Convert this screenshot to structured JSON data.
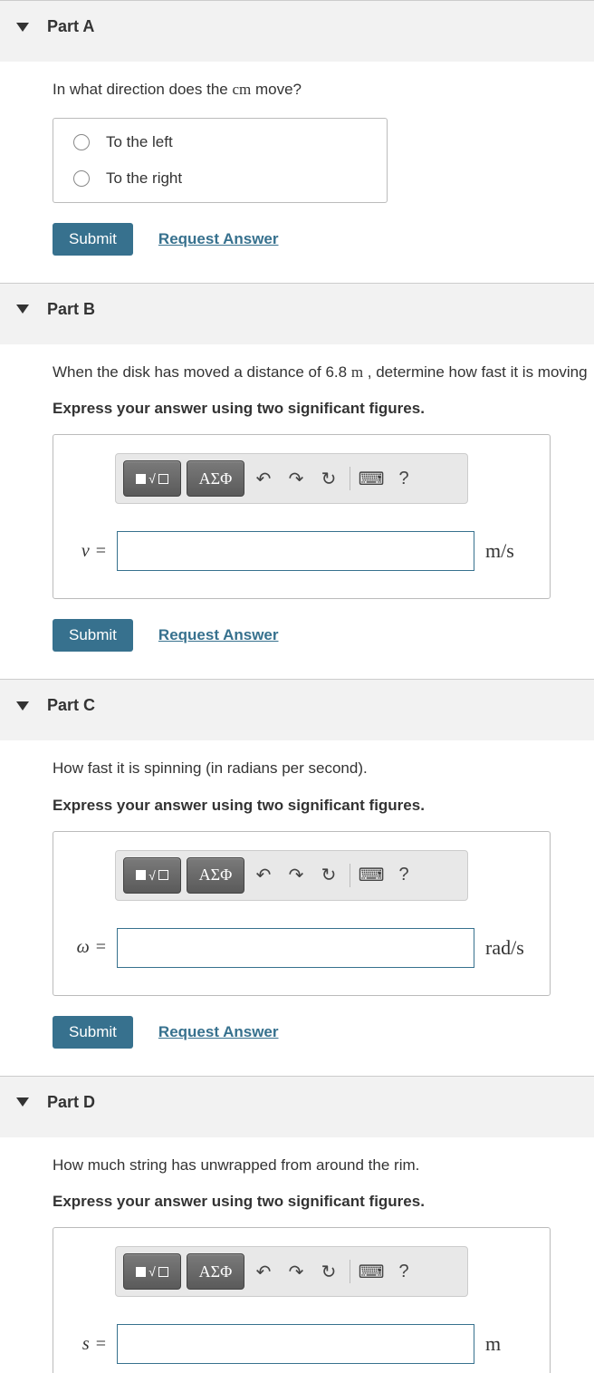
{
  "buttons": {
    "submit": "Submit",
    "request": "Request Answer"
  },
  "toolbar": {
    "help": "?",
    "greek": "ΑΣΦ"
  },
  "partA": {
    "title": "Part A",
    "question_prefix": "In what direction does the ",
    "question_cm": "cm",
    "question_suffix": " move?",
    "options": [
      "To the left",
      "To the right"
    ]
  },
  "partB": {
    "title": "Part B",
    "question_prefix": "When the disk has moved a distance of 6.8 ",
    "question_unit": "m",
    "question_suffix": " , determine how fast it is moving",
    "instruction": "Express your answer using two significant figures.",
    "var": "v",
    "units_html": "m/s"
  },
  "partC": {
    "title": "Part C",
    "question": "How fast it is spinning (in radians per second).",
    "instruction": "Express your answer using two significant figures.",
    "var": "ω",
    "units_html": "rad/s"
  },
  "partD": {
    "title": "Part D",
    "question": "How much string has unwrapped from around the rim.",
    "instruction": "Express your answer using two significant figures.",
    "var": "s",
    "units_html": "m"
  }
}
